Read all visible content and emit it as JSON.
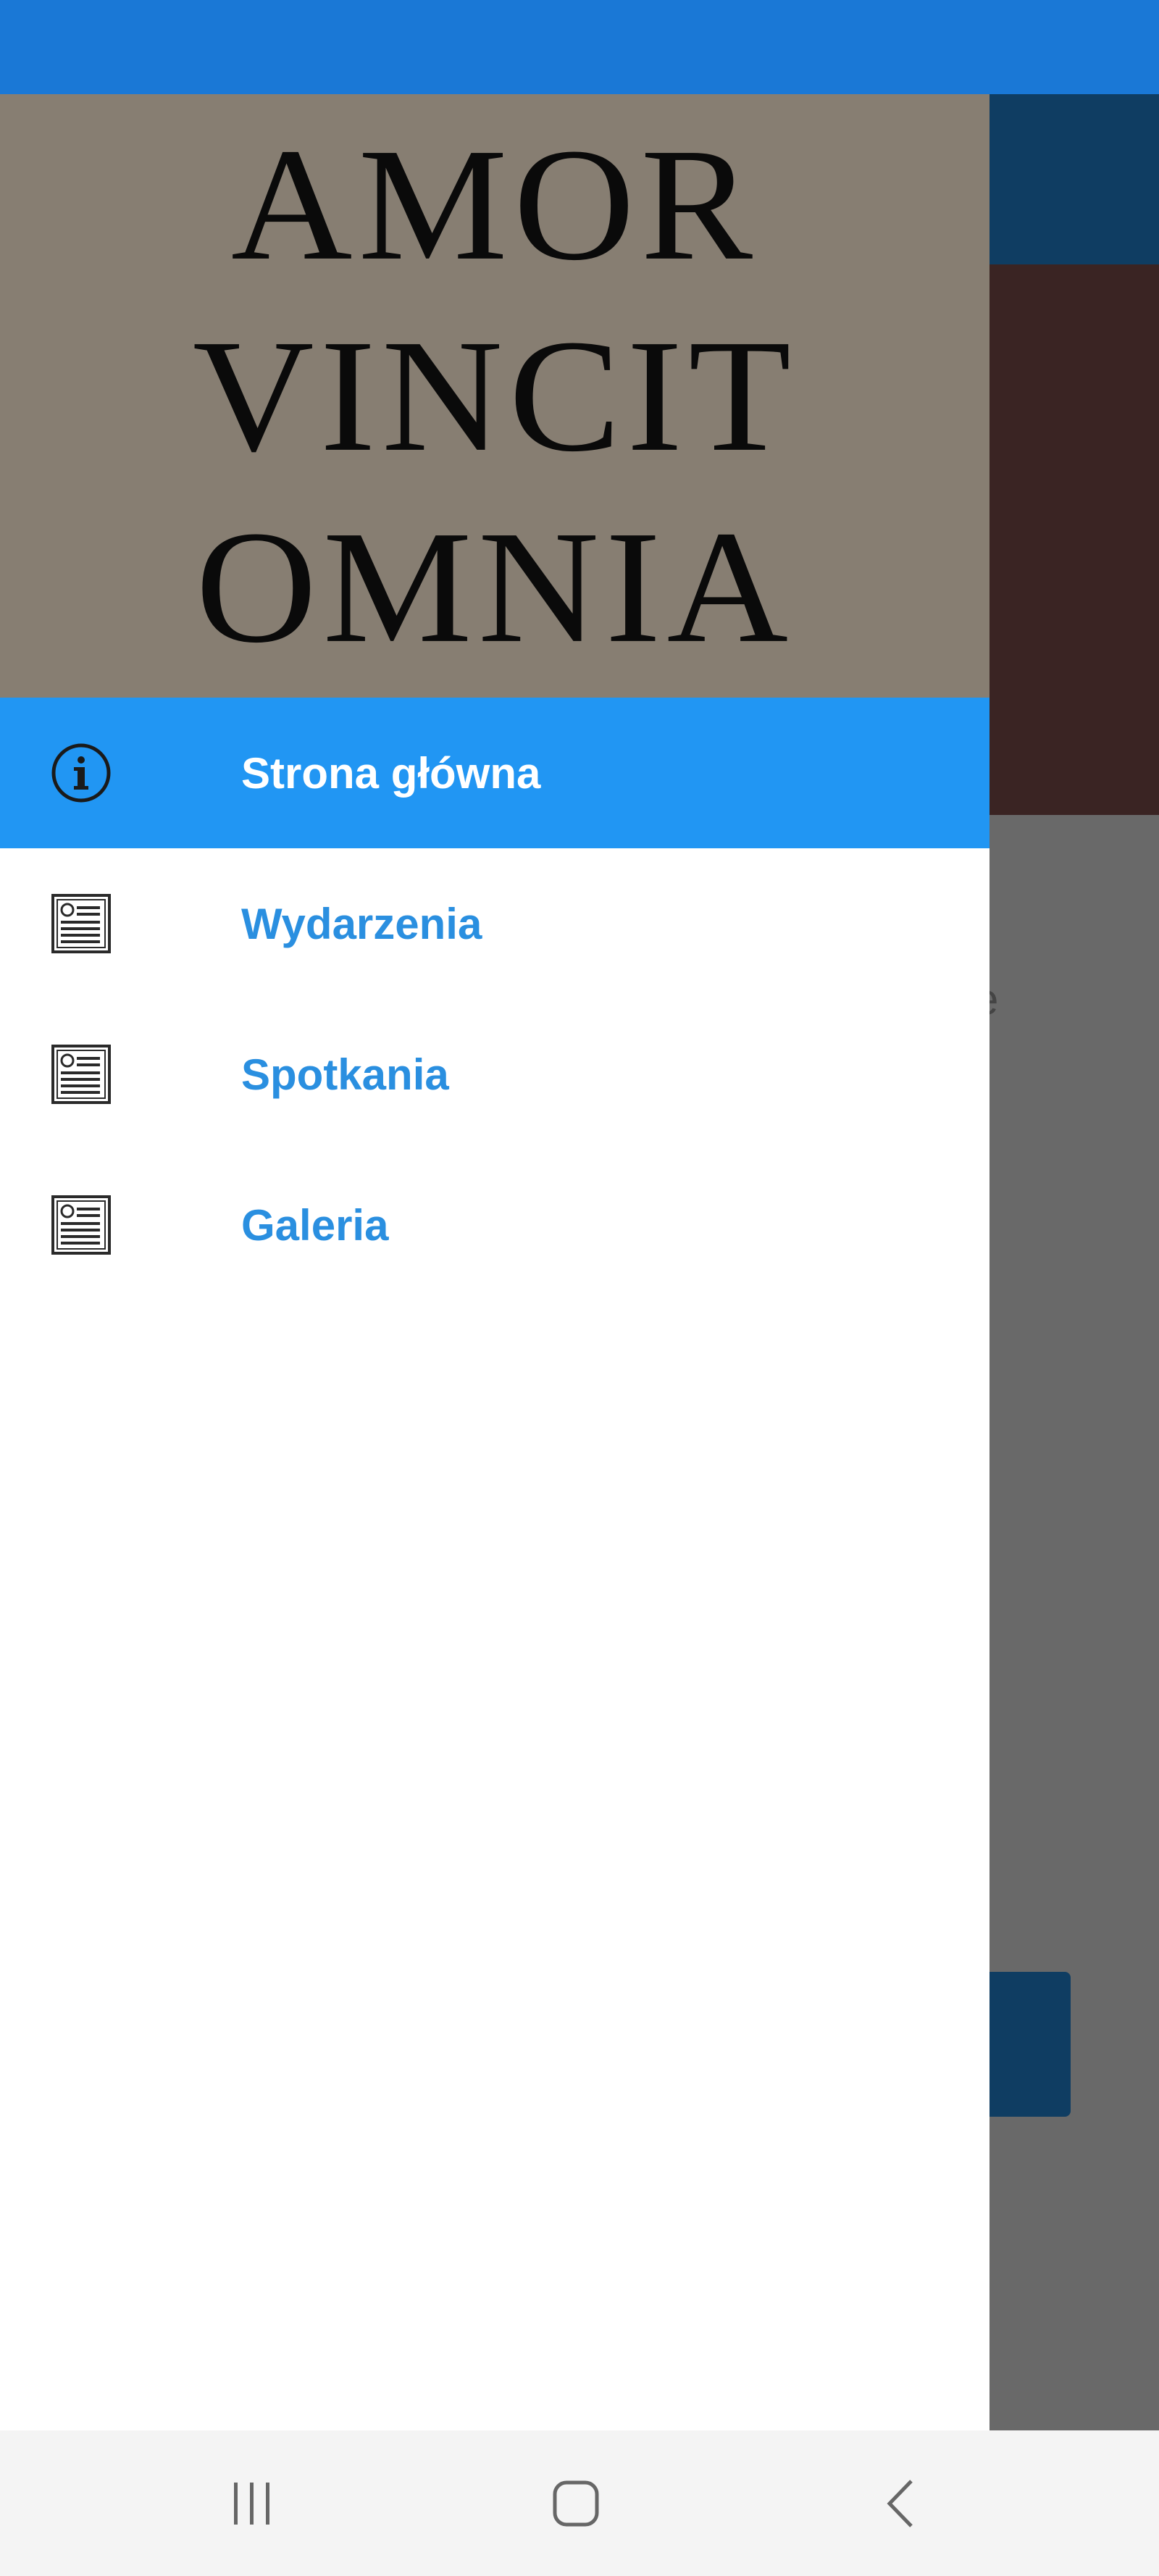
{
  "drawer": {
    "header": {
      "motto_lines": [
        "AMOR",
        "VINCIT",
        "OMNIA"
      ]
    },
    "items": [
      {
        "label": "Strona główna",
        "icon": "info-icon",
        "active": true
      },
      {
        "label": "Wydarzenia",
        "icon": "newspaper-icon",
        "active": false
      },
      {
        "label": "Spotkania",
        "icon": "newspaper-icon",
        "active": false
      },
      {
        "label": "Galeria",
        "icon": "newspaper-icon",
        "active": false
      }
    ]
  },
  "background_page": {
    "text_fragment": "e"
  },
  "nav_bar": {
    "buttons": [
      "recent-apps-icon",
      "home-icon",
      "back-icon"
    ]
  },
  "colors": {
    "status_bar": "#1a78d6",
    "active_item_bg": "#2196f3",
    "item_label": "#2a8fe0",
    "header_bg": "#877e72",
    "scrim": "#696969"
  }
}
